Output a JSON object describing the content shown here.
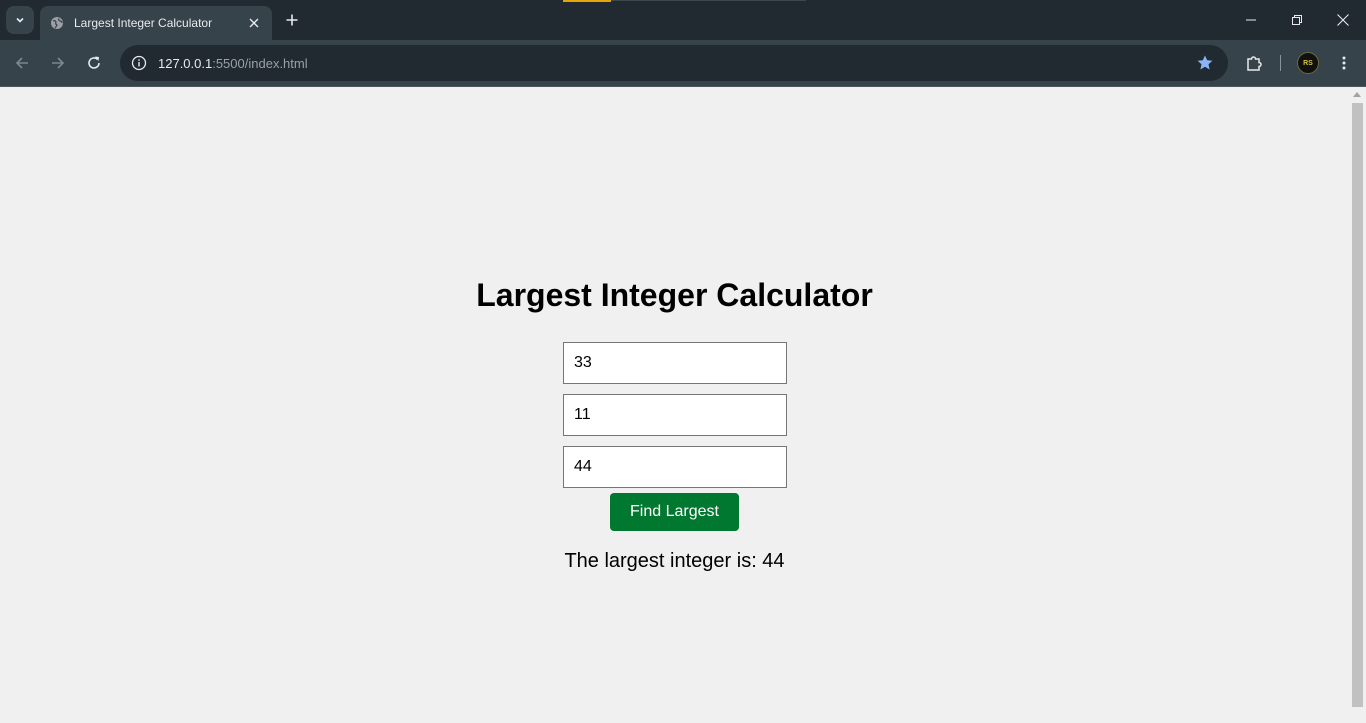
{
  "browser": {
    "tab_title": "Largest Integer Calculator",
    "url_host": "127.0.0.1",
    "url_rest": ":5500/index.html",
    "avatar_text": "RS"
  },
  "page": {
    "heading": "Largest Integer Calculator",
    "inputs": [
      "33",
      "11",
      "44"
    ],
    "button_label": "Find Largest",
    "result_text": "The largest integer is: 44",
    "button_color": "#00782f"
  }
}
